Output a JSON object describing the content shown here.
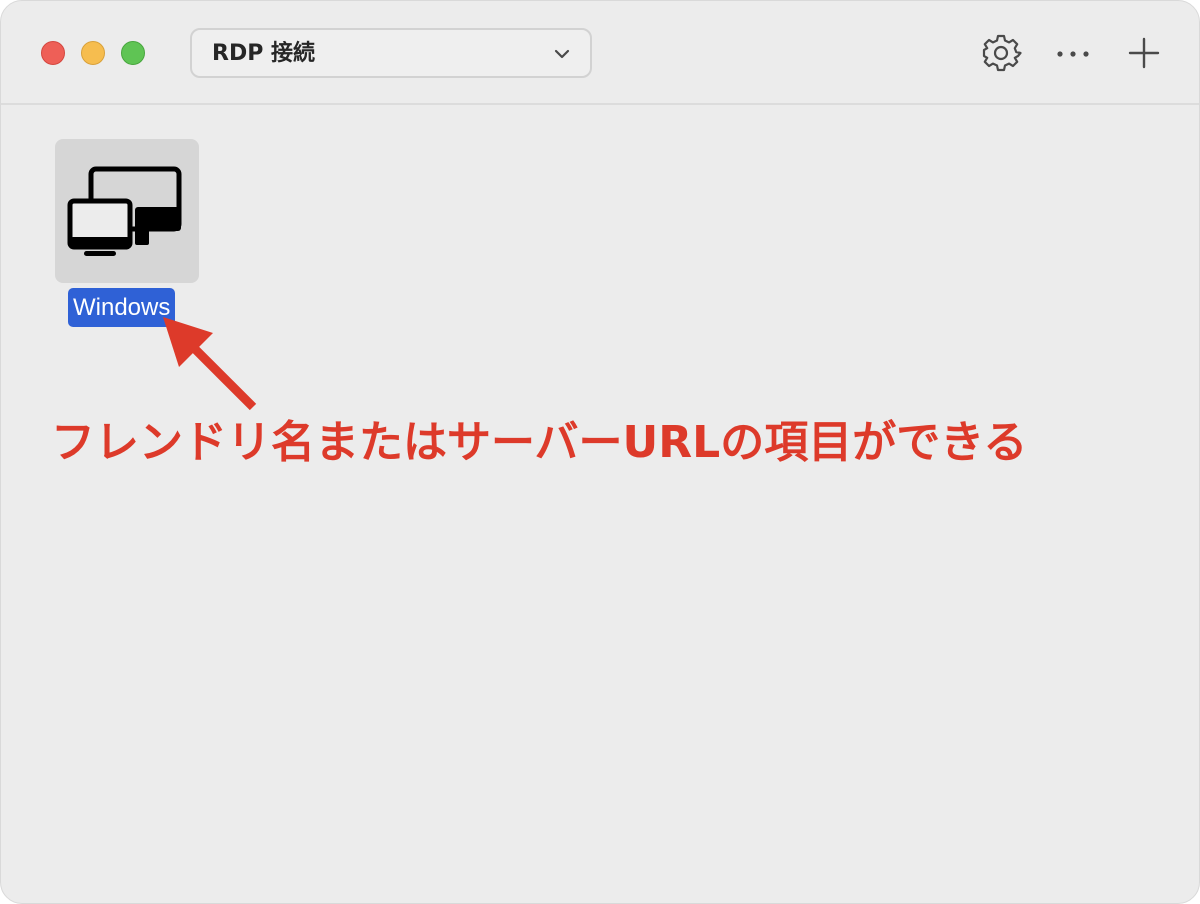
{
  "toolbar": {
    "folder_selector": "RDP 接続",
    "gear_icon": "gear-icon",
    "more_icon": "ellipsis-icon",
    "add_icon": "plus-icon"
  },
  "connections": [
    {
      "label": "Windows",
      "icon": "devices-icon"
    }
  ],
  "annotation": {
    "text": "フレンドリ名またはサーバーURLの項目ができる",
    "color": "#dd3a2a"
  },
  "colors": {
    "selection": "#2f61d6",
    "close": "#ee5f57",
    "minimize": "#f6bd4f",
    "zoom": "#5fc454"
  }
}
